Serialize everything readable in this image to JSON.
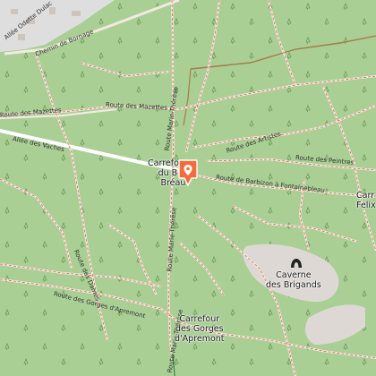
{
  "map": {
    "type": "forest trail map",
    "colors": {
      "forest": "#a9cf95",
      "town": "#dedede",
      "rock": "#ddd8d4",
      "path": "#f3e9e2",
      "path_edge": "#d9694d",
      "main_road": "#ffffff",
      "track": "#a87a4a",
      "marker": "#f56b3c"
    },
    "labels": {
      "allee_odette": "Allée Odette Dulac",
      "chemin_bornage": "Chemin de Bornage",
      "route_mazettes": "Route des Mazettes",
      "route_mazettes_2": "Route des Mazettes",
      "allee_vaches": "Allée des Vaches",
      "route_marie_therese": "Route Marie-Thérèse",
      "route_marie_therese_2": "Route Marie-Thérèse",
      "route_marie_therese_3": "Route Marie-Thérèse",
      "route_artistes": "Route des Artistes",
      "route_peintres": "Route des Peintres",
      "route_barbizon": "Route de Barbizon à Fontainebleau",
      "route_dames": "Route des Dames",
      "route_gorges": "Route des Gorges d'Apremont",
      "carrefour_breau_line1": "Carrefour",
      "carrefour_breau_line2": "du B",
      "carrefour_breau_line3": "Bréau",
      "carrefour_felix_line1": "Carr",
      "carrefour_felix_line2": "Felix",
      "caverne_line1": "Caverne",
      "caverne_line2": "des Brigands",
      "carrefour_gorges_line1": "Carrefour",
      "carrefour_gorges_line2": "des Gorges",
      "carrefour_gorges_line3": "d'Apremont"
    },
    "icons": {
      "poi_marker": "map-pin-icon",
      "cave": "cave-icon"
    }
  }
}
